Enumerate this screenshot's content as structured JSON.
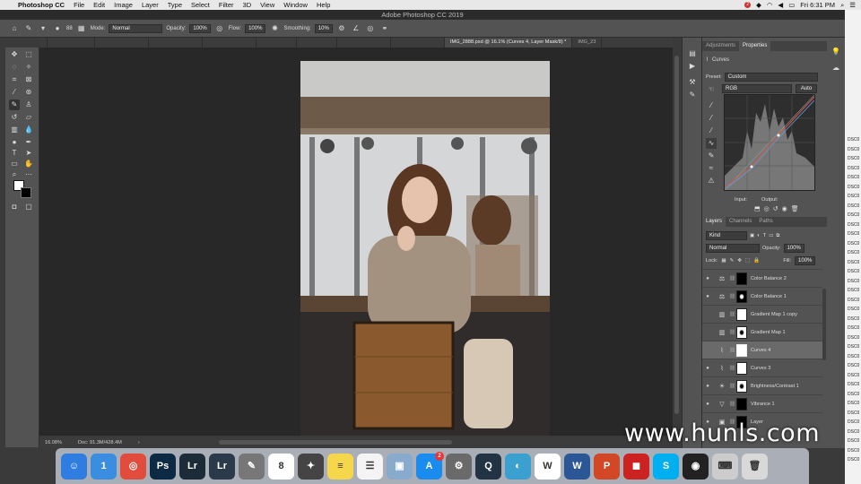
{
  "menubar": {
    "app": "Photoshop CC",
    "menus": [
      "File",
      "Edit",
      "Image",
      "Layer",
      "Type",
      "Select",
      "Filter",
      "3D",
      "View",
      "Window",
      "Help"
    ],
    "badge": "2",
    "clock": "Fri 6:31 PM"
  },
  "window_title": "Adobe Photoshop CC 2019",
  "options": {
    "brush_size": "88",
    "mode_label": "Mode:",
    "mode_value": "Normal",
    "opacity_label": "Opacity:",
    "opacity_value": "100%",
    "flow_label": "Flow:",
    "flow_value": "100%",
    "smoothing_label": "Smoothing:",
    "smoothing_value": "10%"
  },
  "tabs": [
    {
      "label": "IMG_2888.psd @ 16.1% (Curves 4, Layer Mask/8) *",
      "active": true
    },
    {
      "label": "IMG_23",
      "active": false
    }
  ],
  "status": {
    "zoom": "16.08%",
    "doc": "Doc: 91.3M/428.4M"
  },
  "properties": {
    "tabs": [
      "Adjustments",
      "Properties"
    ],
    "title": "Curves",
    "preset_label": "Preset:",
    "preset_value": "Custom",
    "channel": "RGB",
    "auto": "Auto",
    "input_label": "Input:",
    "output_label": "Output:"
  },
  "layers_panel": {
    "tabs": [
      "Layers",
      "Channels",
      "Paths"
    ],
    "kind": "Kind",
    "blend": "Normal",
    "opacity_label": "Opacity:",
    "opacity_value": "100%",
    "lock_label": "Lock:",
    "fill_label": "Fill:",
    "fill_value": "100%",
    "layers": [
      {
        "name": "Color Balance 2",
        "icon": "balance-icon",
        "visible": true,
        "mask": "black",
        "selected": false
      },
      {
        "name": "Color Balance 1",
        "icon": "balance-icon",
        "visible": true,
        "mask": "black-figure",
        "selected": false
      },
      {
        "name": "Gradient Map 1 copy",
        "icon": "gradient-map-icon",
        "visible": false,
        "mask": "white",
        "selected": false
      },
      {
        "name": "Gradient Map 1",
        "icon": "gradient-map-icon",
        "visible": false,
        "mask": "white-figure",
        "selected": false
      },
      {
        "name": "Curves 4",
        "icon": "curves-icon",
        "visible": false,
        "mask": "white",
        "selected": true
      },
      {
        "name": "Curves 3",
        "icon": "curves-icon",
        "visible": true,
        "mask": "white",
        "selected": false
      },
      {
        "name": "Brightness/Contrast 1",
        "icon": "brightness-icon",
        "visible": true,
        "mask": "white-figure",
        "selected": false
      },
      {
        "name": "Vibrance 1",
        "icon": "vibrance-icon",
        "visible": true,
        "mask": "black",
        "selected": false
      },
      {
        "name": "Layer",
        "icon": "layer-icon",
        "visible": true,
        "mask": "black",
        "selected": false
      }
    ]
  },
  "desktop_files": [
    "DSC0",
    "DSC0",
    "DSC0",
    "DSC0",
    "DSC0",
    "DSC0",
    "DSC0",
    "DSC0",
    "DSC0",
    "DSC0",
    "DSC0",
    "DSC0",
    "DSC0",
    "DSC0",
    "DSC0",
    "DSC0",
    "DSC0",
    "DSC0",
    "DSC0",
    "DSC0",
    "DSC0",
    "DSC0",
    "DSC0",
    "DSC0",
    "DSC0",
    "DSC0",
    "DSC0",
    "DSC0",
    "DSC0",
    "DSC0",
    "DSC0",
    "DSC0",
    "DSC0",
    "DSC0",
    "DSC0"
  ],
  "dock": [
    {
      "name": "finder-icon",
      "glyph": "☺",
      "color": "#2f7de1"
    },
    {
      "name": "1password-icon",
      "glyph": "1",
      "color": "#3b8de0"
    },
    {
      "name": "chrome-icon",
      "glyph": "◎",
      "color": "#e24c3c"
    },
    {
      "name": "photoshop-icon",
      "glyph": "Ps",
      "color": "#0c2a44"
    },
    {
      "name": "lightroom-icon",
      "glyph": "Lr",
      "color": "#1c2b38"
    },
    {
      "name": "lightroom-classic-icon",
      "glyph": "Lr",
      "color": "#2a3a4a"
    },
    {
      "name": "script-editor-icon",
      "glyph": "✎",
      "color": "#777"
    },
    {
      "name": "calendar-icon",
      "glyph": "8",
      "color": "#ffffff"
    },
    {
      "name": "final-cut-icon",
      "glyph": "✦",
      "color": "#444"
    },
    {
      "name": "notes-icon",
      "glyph": "≡",
      "color": "#f6d64a"
    },
    {
      "name": "reminders-icon",
      "glyph": "☰",
      "color": "#f4f4f4"
    },
    {
      "name": "preview-icon",
      "glyph": "▣",
      "color": "#88aacc"
    },
    {
      "name": "app-store-icon",
      "glyph": "A",
      "color": "#1a8cf0",
      "badge": "2"
    },
    {
      "name": "system-preferences-icon",
      "glyph": "⚙",
      "color": "#6a6a6a"
    },
    {
      "name": "quicktime-icon",
      "glyph": "Q",
      "color": "#234"
    },
    {
      "name": "colorsync-icon",
      "glyph": "◐",
      "color": "#3aa0d0"
    },
    {
      "name": "wunderlist-icon",
      "glyph": "W",
      "color": "#ffffff"
    },
    {
      "name": "word-icon",
      "glyph": "W",
      "color": "#2b5797"
    },
    {
      "name": "powerpoint-icon",
      "glyph": "P",
      "color": "#d24726"
    },
    {
      "name": "flashcard-icon",
      "glyph": "◼",
      "color": "#cc2222"
    },
    {
      "name": "skype-icon",
      "glyph": "S",
      "color": "#00aff0"
    },
    {
      "name": "obs-icon",
      "glyph": "◉",
      "color": "#222"
    },
    {
      "name": "keyboard-icon",
      "glyph": "⌨",
      "color": "#ccc"
    },
    {
      "name": "trash-icon",
      "glyph": "🗑",
      "color": "#d8d8d8"
    }
  ],
  "watermark": "www.hunls.com",
  "colors": {
    "accent": "#1473e6",
    "panel": "#535353",
    "canvas": "#282828"
  }
}
